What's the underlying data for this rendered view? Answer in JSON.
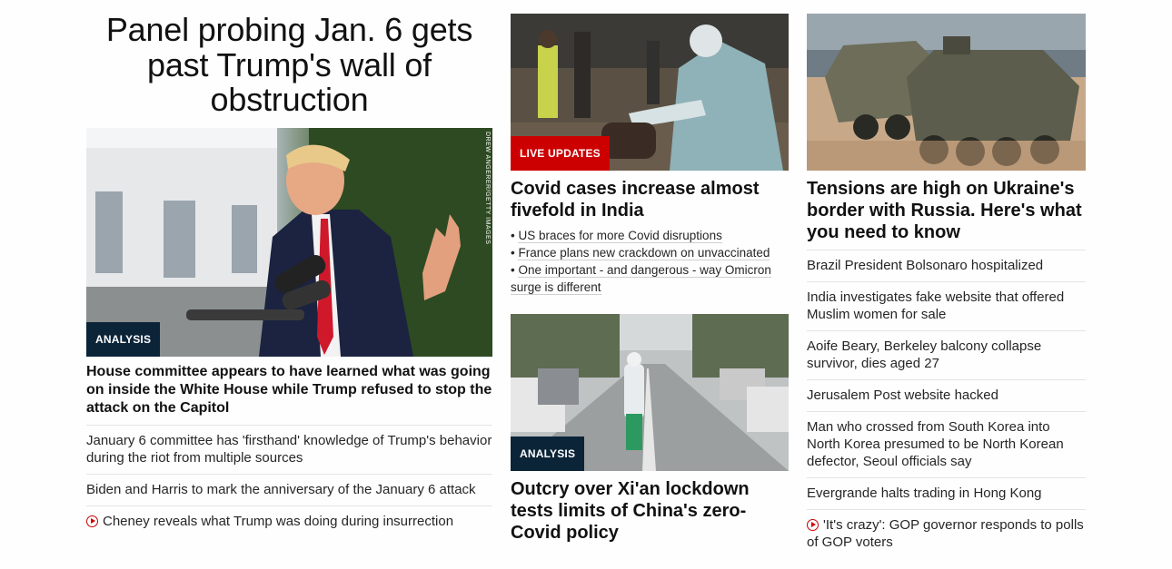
{
  "col1": {
    "hero_title": "Panel probing Jan. 6 gets past Trump's wall of obstruction",
    "image_badge": "ANALYSIS",
    "photo_credit": "DREW ANGERER/GETTY IMAGES",
    "headline": "House committee appears to have learned what was going on inside the White House while Trump refused to stop the attack on the Capitol",
    "links": [
      {
        "text": "January 6 committee has 'firsthand' knowledge of Trump's behavior during the riot from multiple sources"
      },
      {
        "text": "Biden and Harris to mark the anniversary of the January 6 attack"
      },
      {
        "text": "Cheney reveals what Trump was doing during insurrection",
        "icon": "play-icon"
      }
    ]
  },
  "col2": {
    "card1": {
      "badge": "LIVE UPDATES",
      "headline": "Covid cases increase almost fivefold in India",
      "bullets": [
        "US braces for more Covid disruptions",
        "France plans new crackdown on unvaccinated",
        "One important - and dangerous - way Omicron surge is different"
      ]
    },
    "card2": {
      "badge": "ANALYSIS",
      "headline": "Outcry over Xi'an lockdown tests limits of China's zero-Covid policy"
    }
  },
  "col3": {
    "headline": "Tensions are high on Ukraine's border with Russia. Here's what you need to know",
    "links": [
      {
        "text": "Brazil President Bolsonaro hospitalized"
      },
      {
        "text": "India investigates fake website that offered Muslim women for sale"
      },
      {
        "text": "Aoife Beary, Berkeley balcony collapse survivor, dies aged 27"
      },
      {
        "text": "Jerusalem Post website hacked"
      },
      {
        "text": "Man who crossed from South Korea into North Korea presumed to be North Korean defector, Seoul officials say"
      },
      {
        "text": "Evergrande halts trading in Hong Kong"
      },
      {
        "text": "'It's crazy': GOP governor responds to polls of GOP voters",
        "icon": "play-icon"
      }
    ]
  },
  "colors": {
    "analysis_badge": "#0b2438",
    "live_badge": "#cc0000",
    "video_icon": "#cc0000"
  }
}
